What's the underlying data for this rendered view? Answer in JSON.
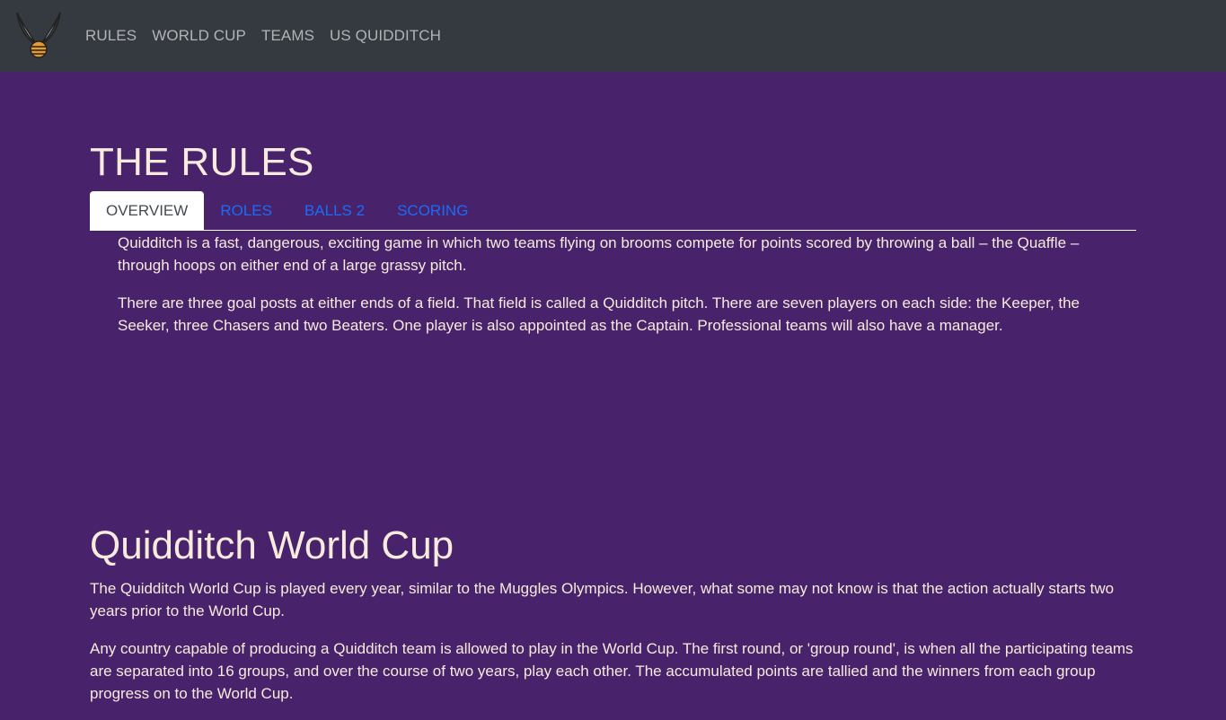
{
  "navbar": {
    "links": [
      "RULES",
      "WORLD CUP",
      "TEAMS",
      "US QUIDDITCH"
    ]
  },
  "rules": {
    "title": "THE RULES",
    "tabs": [
      "OVERVIEW",
      "ROLES",
      "BALLS 2",
      "SCORING"
    ],
    "active_tab": "OVERVIEW",
    "paragraphs": [
      "Quidditch is a fast, dangerous, exciting game in which two teams flying on brooms compete for points scored by throwing a ball – the Quaffle – through hoops on either end of a large grassy pitch.",
      "There are three goal posts at either ends of a field. That field is called a Quidditch pitch. There are seven players on each side: the Keeper, the Seeker, three Chasers and two Beaters. One player is also appointed as the Captain. Professional teams will also have a manager."
    ]
  },
  "world_cup": {
    "title": "Quidditch World Cup",
    "paragraphs": [
      "The Quidditch World Cup is played every year, similar to the Muggles Olympics. However, what some may not know is that the action actually starts two years prior to the World Cup.",
      "Any country capable of producing a Quidditch team is allowed to play in the World Cup. The first round, or 'group round', is when all the participating teams are separated into 16 groups, and over the course of two years, play each other. The accumulated points are tallied and the winners from each group progress on to the World Cup."
    ]
  },
  "colors": {
    "background": "#48236b",
    "navbar": "#353a40",
    "text": "#f7ebde",
    "tab_link": "#1a6cf5"
  },
  "icons": {
    "logo": "golden-snitch-icon"
  }
}
